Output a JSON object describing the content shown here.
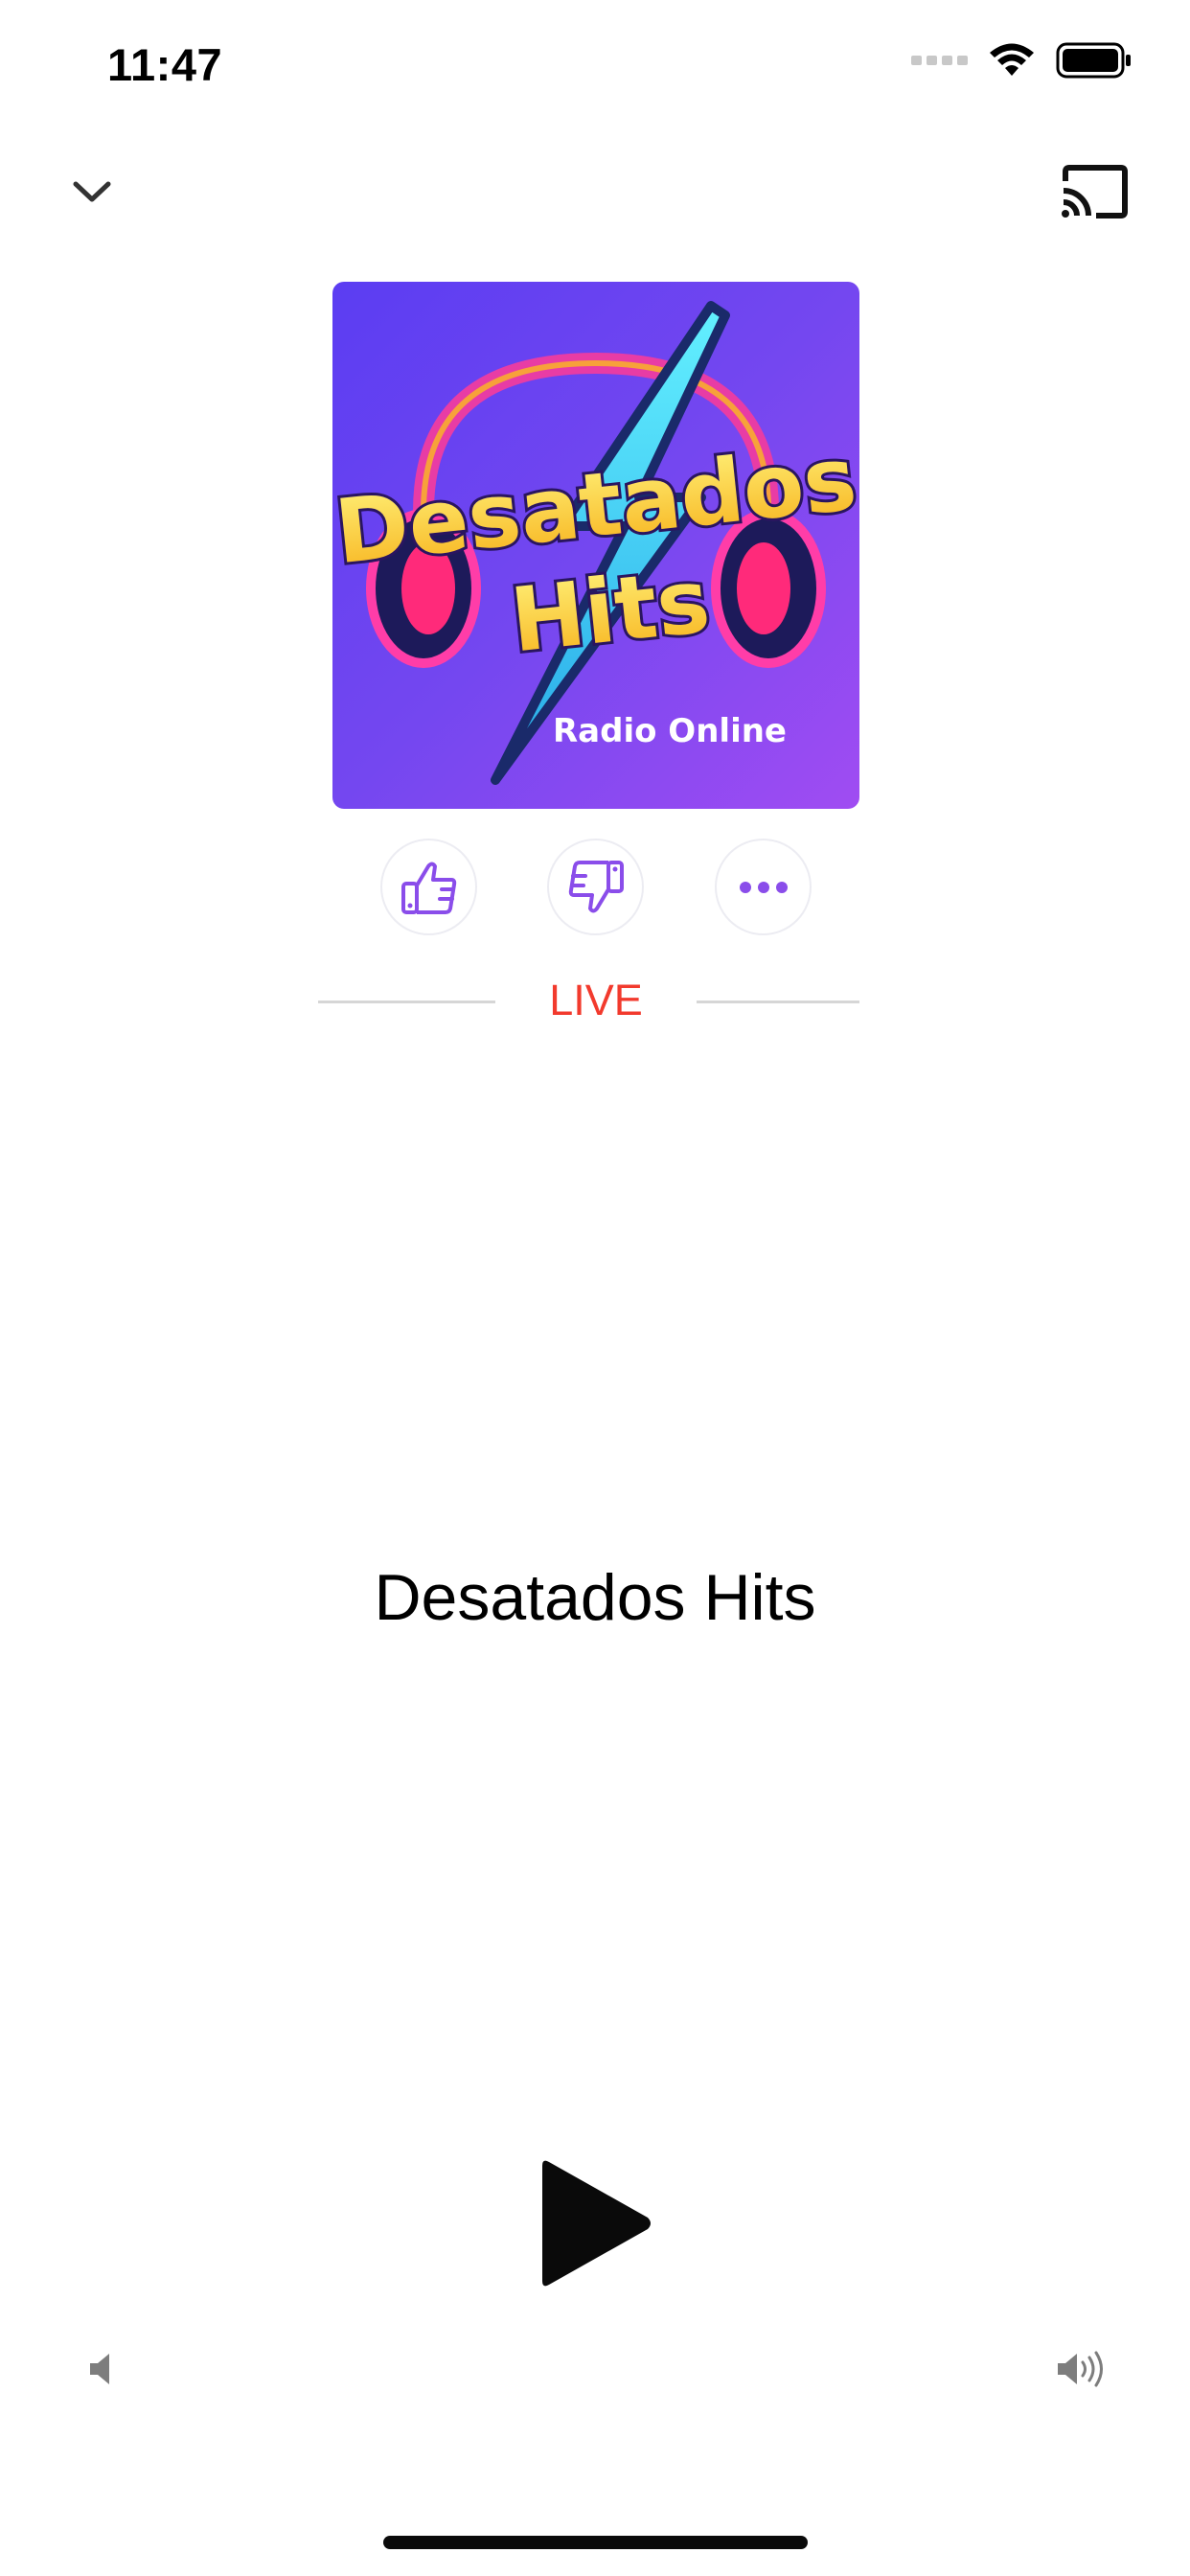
{
  "status_bar": {
    "time": "11:47"
  },
  "artwork": {
    "line1": "Desatados",
    "line2": "Hits",
    "tagline": "Radio Online",
    "background": "#7a46f0"
  },
  "actions": {
    "like_icon": "thumbs-up-icon",
    "dislike_icon": "thumbs-down-icon",
    "more_icon": "ellipsis-icon",
    "accent": "#8a4dea"
  },
  "live_label": "LIVE",
  "live_color": "#f23a2d",
  "station": {
    "title": "Desatados Hits"
  },
  "controls": {
    "play_icon": "play-icon",
    "volume_low_icon": "volume-low-icon",
    "volume_high_icon": "volume-high-icon"
  }
}
